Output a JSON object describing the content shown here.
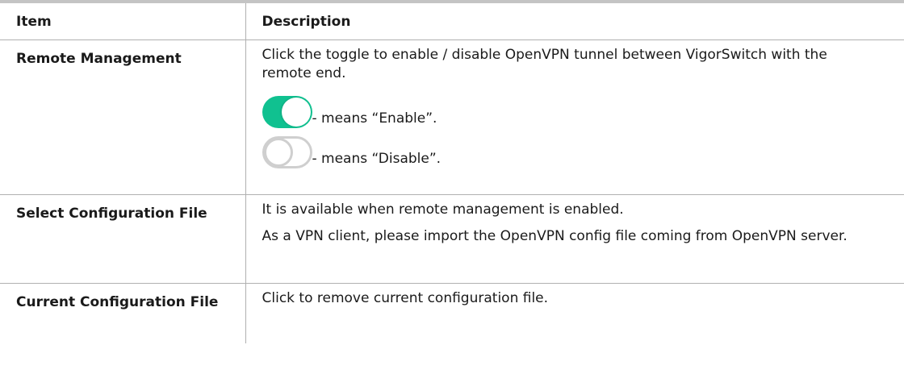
{
  "table": {
    "headers": {
      "item": "Item",
      "description": "Description"
    },
    "rows": [
      {
        "item": "Remote Management",
        "paragraphs": [
          "Click the toggle to enable / disable OpenVPN tunnel between VigorSwitch with the remote end."
        ],
        "toggles": [
          {
            "state": "on",
            "caption": "- means “Enable”.",
            "icon": "toggle-on-icon",
            "color": "#10c190"
          },
          {
            "state": "off",
            "caption": "- means “Disable”.",
            "icon": "toggle-off-icon",
            "color": "#cfcfcf"
          }
        ]
      },
      {
        "item": "Select Configuration File",
        "paragraphs": [
          "It is available when remote management is enabled.",
          "As a VPN client, please import the OpenVPN config file coming from OpenVPN server."
        ]
      },
      {
        "item": "Current Configuration File",
        "paragraphs": [
          "Click to remove current configuration file."
        ]
      }
    ]
  }
}
